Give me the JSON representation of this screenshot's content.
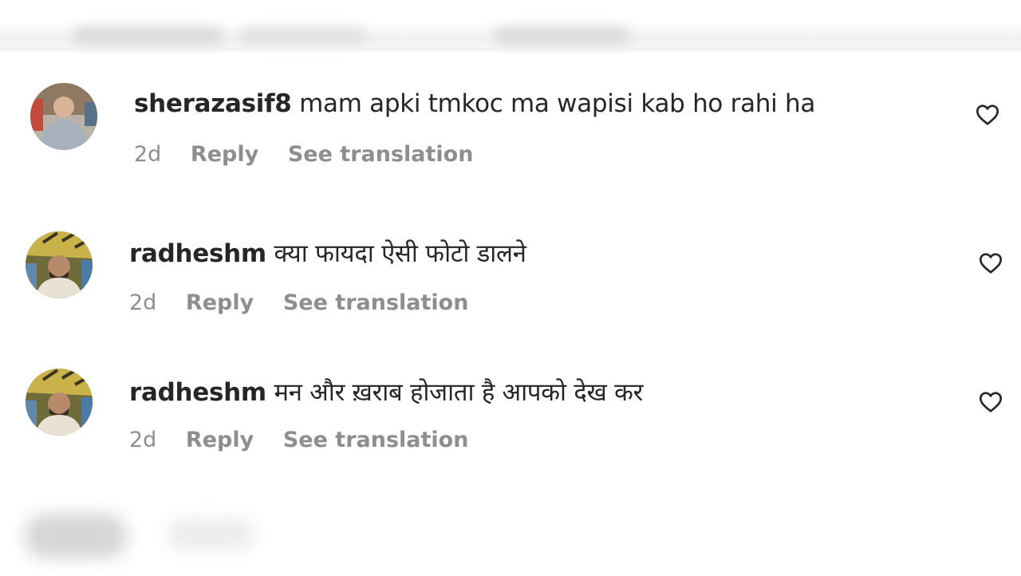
{
  "comments": [
    {
      "username": "sherazasif8",
      "text": "mam apki tmkoc ma wapisi kab ho rahi ha",
      "time": "2d",
      "reply_label": "Reply",
      "translate_label": "See translation",
      "like_icon": "heart-outline"
    },
    {
      "username": "radheshm",
      "text": "क्या फायदा ऐसी फोटो डालने",
      "time": "2d",
      "reply_label": "Reply",
      "translate_label": "See translation",
      "like_icon": "heart-outline"
    },
    {
      "username": "radheshm",
      "text": "मन और ख़राब होजाता है आपको देख कर",
      "time": "2d",
      "reply_label": "Reply",
      "translate_label": "See translation",
      "like_icon": "heart-outline"
    }
  ],
  "colors": {
    "text_primary": "#262626",
    "text_secondary": "#8e8e8e",
    "background": "#ffffff"
  }
}
